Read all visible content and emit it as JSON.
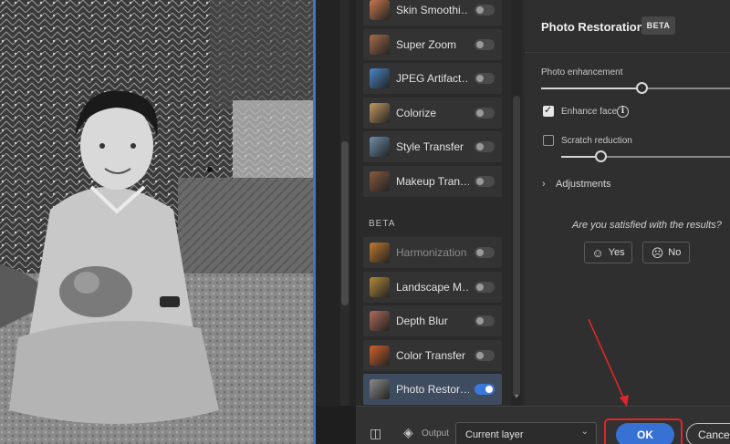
{
  "canvas": {
    "cursor": "hand-cursor"
  },
  "filters": {
    "items": [
      {
        "label": "Skin Smoothi…",
        "icon": "skin-smoothing-thumb",
        "on": false,
        "dim": false,
        "color": "#c9784e"
      },
      {
        "label": "Super Zoom",
        "icon": "super-zoom-thumb",
        "on": false,
        "dim": false,
        "color": "#a86a4c"
      },
      {
        "label": "JPEG Artifact…",
        "icon": "jpeg-artifacts-thumb",
        "on": false,
        "dim": false,
        "color": "#4a86c8"
      },
      {
        "label": "Colorize",
        "icon": "colorize-thumb",
        "on": false,
        "dim": false,
        "color": "#c49a62"
      },
      {
        "label": "Style Transfer",
        "icon": "style-transfer-thumb",
        "on": false,
        "dim": false,
        "color": "#6e8faa"
      },
      {
        "label": "Makeup Tran…",
        "icon": "makeup-transfer-thumb",
        "on": false,
        "dim": false,
        "color": "#8a5a40"
      }
    ],
    "beta_label": "BETA",
    "beta_items": [
      {
        "label": "Harmonization",
        "icon": "harmonization-thumb",
        "on": false,
        "dim": true,
        "color": "#c07a2e"
      },
      {
        "label": "Landscape M…",
        "icon": "landscape-mixer-thumb",
        "on": false,
        "dim": false,
        "color": "#b58a3a"
      },
      {
        "label": "Depth Blur",
        "icon": "depth-blur-thumb",
        "on": false,
        "dim": false,
        "color": "#b06a5a"
      },
      {
        "label": "Color Transfer",
        "icon": "color-transfer-thumb",
        "on": false,
        "dim": false,
        "color": "#d2612a"
      },
      {
        "label": "Photo Restor…",
        "icon": "photo-restoration-thumb",
        "on": true,
        "dim": false,
        "active": true,
        "color": "#8c8c8c"
      }
    ]
  },
  "panel": {
    "title": "Photo Restoration",
    "badge": "BETA",
    "photo_enhancement_label": "Photo enhancement",
    "photo_enhancement_level": 0.5,
    "enhance_face_label": "Enhance face",
    "enhance_face_checked": true,
    "scratch_reduction_label": "Scratch reduction",
    "scratch_reduction_checked": false,
    "scratch_reduction_level": 0.23,
    "adjustments_label": "Adjustments",
    "question": "Are you satisfied with the results?",
    "yes_label": "Yes",
    "no_label": "No"
  },
  "bottom": {
    "output_label": "Output",
    "output_value": "Current layer",
    "ok_label": "OK",
    "cancel_label": "Cancel"
  },
  "colors": {
    "accent": "#3871d4",
    "annotation": "#e0262a"
  }
}
